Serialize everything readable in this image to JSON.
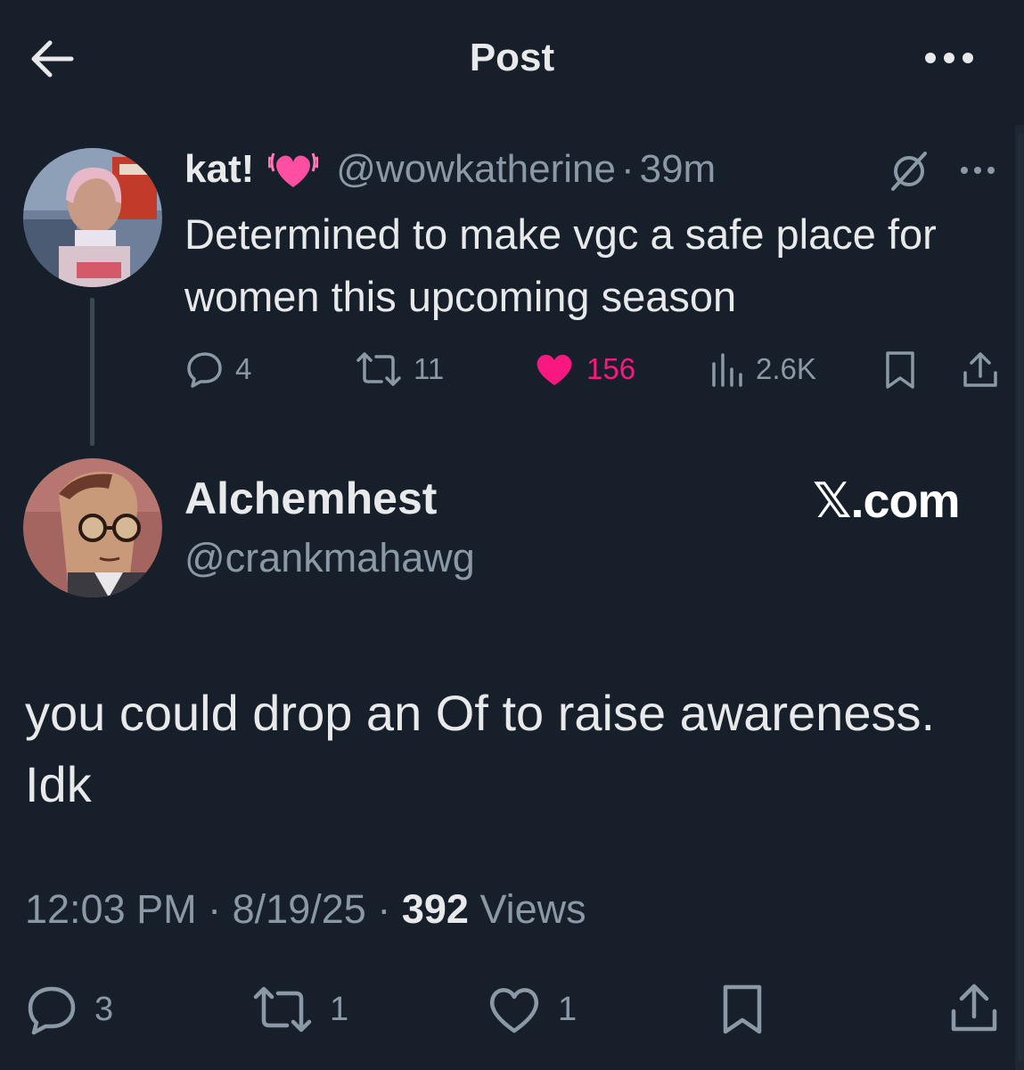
{
  "header": {
    "title": "Post"
  },
  "original_post": {
    "display_name": "kat!",
    "handle": "@wowkatherine",
    "separator": "·",
    "time": "39m",
    "text": "Determined to make vgc a safe place for women this upcoming season",
    "stats": {
      "replies": "4",
      "reposts": "11",
      "likes": "156",
      "views": "2.6K"
    },
    "liked": true
  },
  "reply": {
    "display_name": "Alchemhest",
    "handle": "@crankmahawg",
    "watermark": "𝕏.com",
    "text_line1": "you could drop an Of to raise awareness.",
    "text_line2": "Idk",
    "time": "12:03 PM",
    "date": "8/19/25",
    "separator": "·",
    "views_count": "392",
    "views_label": "Views",
    "stats": {
      "replies": "3",
      "reposts": "1",
      "likes": "1"
    }
  },
  "colors": {
    "background": "#17202a",
    "text": "#e7e9ea",
    "muted": "#8b98a5",
    "like": "#f91880"
  },
  "icons": [
    "back-arrow-icon",
    "more-icon",
    "heart-emoji-icon",
    "grok-icon",
    "reply-icon",
    "repost-icon",
    "like-icon",
    "views-icon",
    "bookmark-icon",
    "share-icon"
  ]
}
